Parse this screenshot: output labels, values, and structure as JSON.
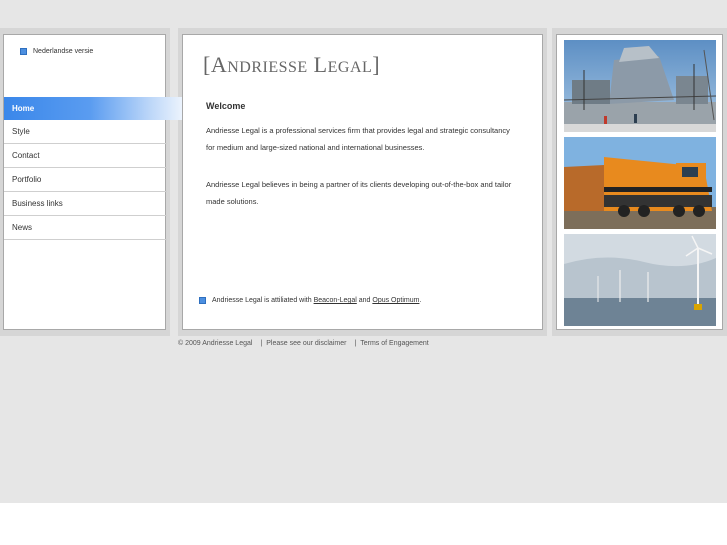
{
  "language_link": "Nederlandse versie",
  "nav": {
    "items": [
      {
        "label": "Home",
        "active": true
      },
      {
        "label": "Style",
        "active": false
      },
      {
        "label": "Contact",
        "active": false
      },
      {
        "label": "Portfolio",
        "active": false
      },
      {
        "label": "Business links",
        "active": false
      },
      {
        "label": "News",
        "active": false
      }
    ]
  },
  "logo": {
    "bracket_open": "[",
    "word1_cap": "A",
    "word1_rest": "NDRIESSE",
    "word2_cap": "L",
    "word2_rest": "EGAL",
    "bracket_close": "]"
  },
  "main": {
    "heading": "Welcome",
    "paragraph1": "Andriesse Legal is a professional services firm that provides legal and strategic consultancy for medium and large-sized national and international businesses.",
    "paragraph2": "Andriesse Legal believes in being a partner of its clients developing out-of-the-box and tailor made solutions.",
    "affiliation_prefix": "Andriesse Legal is attiliated with",
    "affiliation_link1": "Beacon-Legal",
    "affiliation_and": "and",
    "affiliation_link2": "Opus Optimum",
    "affiliation_suffix": "."
  },
  "photos": [
    "industrial-platform",
    "orange-locomotive",
    "offshore-wind-turbines"
  ],
  "footer": {
    "copyright": "© 2009 Andriesse Legal",
    "separator": "|",
    "disclaimer": "Please see our disclaimer",
    "terms": "Terms of Engagement"
  },
  "colors": {
    "accent": "#3a87ea",
    "page_background": "#e6e6e6"
  }
}
